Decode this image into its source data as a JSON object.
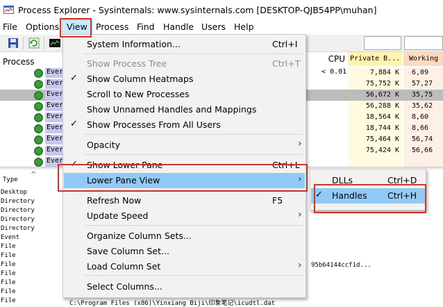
{
  "window": {
    "title": "Process Explorer - Sysinternals: www.sysinternals.com [DESKTOP-QJB54PP\\muhan]"
  },
  "menubar": [
    "File",
    "Options",
    "View",
    "Process",
    "Find",
    "Handle",
    "Users",
    "Help"
  ],
  "process_pane": {
    "headers": {
      "process": "Process",
      "cpu": "CPU",
      "private": "Private B...",
      "working": "Working"
    },
    "rows": [
      {
        "name": "Ever",
        "cpu": "< 0.01",
        "private": "7,884 K",
        "working": "6,09"
      },
      {
        "name": "Ever",
        "cpu": "",
        "private": "75,752 K",
        "working": "57,27"
      },
      {
        "name": "Ever",
        "cpu": "",
        "private": "56,672 K",
        "working": "35,75"
      },
      {
        "name": "Ever",
        "cpu": "",
        "private": "56,288 K",
        "working": "35,62"
      },
      {
        "name": "Ever",
        "cpu": "",
        "private": "18,564 K",
        "working": "8,60"
      },
      {
        "name": "Ever",
        "cpu": "",
        "private": "18,744 K",
        "working": "8,66"
      },
      {
        "name": "Ever",
        "cpu": "",
        "private": "75,464 K",
        "working": "56,74"
      },
      {
        "name": "Ever",
        "cpu": "",
        "private": "75,424 K",
        "working": "56,66"
      },
      {
        "name": "Ever",
        "cpu": "",
        "private": "",
        "working": ""
      }
    ],
    "selected_row": 2
  },
  "lower_pane": {
    "header": "Type",
    "sort_glyph": "^",
    "rows": [
      "Desktop",
      "Directory",
      "Directory",
      "Directory",
      "Directory",
      "Event",
      "File",
      "File",
      "File",
      "File",
      "File",
      "File",
      "File"
    ],
    "fragment_text": "95b64144ccf1d...",
    "path_text": "C:\\Program Files (x86)\\Yinxiang Biji\\印象笔记\\icudtl.dat"
  },
  "view_menu": {
    "items": [
      {
        "label": "System Information...",
        "shortcut": "Ctrl+I"
      },
      {
        "label": "Show Process Tree",
        "shortcut": "Ctrl+T",
        "disabled": true
      },
      {
        "label": "Show Column Heatmaps",
        "checked": true
      },
      {
        "label": "Scroll to New Processes"
      },
      {
        "label": "Show Unnamed Handles and Mappings"
      },
      {
        "label": "Show Processes From All Users",
        "checked": true
      },
      {
        "label": "Opacity",
        "submenu": true
      },
      {
        "label": "Show Lower Pane",
        "shortcut": "Ctrl+L",
        "checked": true
      },
      {
        "label": "Lower Pane View",
        "submenu": true,
        "highlighted": true
      },
      {
        "label": "Refresh Now",
        "shortcut": "F5"
      },
      {
        "label": "Update Speed",
        "submenu": true
      },
      {
        "label": "Organize Column Sets..."
      },
      {
        "label": "Save Column Set..."
      },
      {
        "label": "Load Column Set",
        "submenu": true
      },
      {
        "label": "Select Columns..."
      }
    ]
  },
  "lower_pane_submenu": {
    "items": [
      {
        "label": "DLLs",
        "shortcut": "Ctrl+D"
      },
      {
        "label": "Handles",
        "shortcut": "Ctrl+H",
        "checked": true,
        "highlighted": true
      }
    ]
  },
  "icons": {
    "check": "✓",
    "submenu_arrow": "›"
  },
  "colors": {
    "highlight": "#91c9f7",
    "annotation_red": "#d0352b",
    "private_header": "#fff3b0",
    "working_header": "#ffd9bf"
  }
}
